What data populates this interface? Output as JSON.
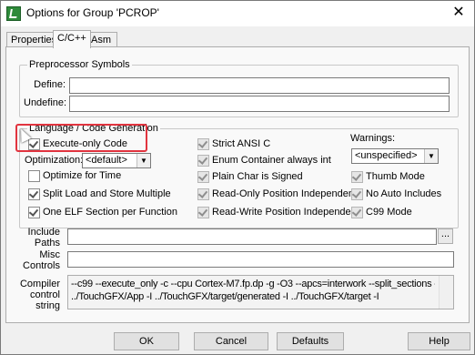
{
  "window": {
    "title": "Options for Group 'PCROP'",
    "close_glyph": "✕"
  },
  "tabs": [
    {
      "label": "Properties"
    },
    {
      "label": "C/C++"
    },
    {
      "label": "Asm"
    }
  ],
  "preprocessor": {
    "group_label": "Preprocessor Symbols",
    "define_label": "Define:",
    "define_value": "",
    "undefine_label": "Undefine:",
    "undefine_value": ""
  },
  "language": {
    "group_label": "Language / Code Generation",
    "execute_only": {
      "label": "Execute-only Code",
      "checked": true
    },
    "optimization": {
      "label": "Optimization:",
      "value": "<default>"
    },
    "col1": [
      {
        "label": "Optimize for Time",
        "checked": false
      },
      {
        "label": "Split Load and Store Multiple",
        "checked": true
      },
      {
        "label": "One ELF Section per Function",
        "checked": true
      }
    ],
    "col2": [
      {
        "label": "Strict ANSI C",
        "checked": true
      },
      {
        "label": "Enum Container always int",
        "checked": true
      },
      {
        "label": "Plain Char is Signed",
        "checked": true
      },
      {
        "label": "Read-Only Position Independent",
        "checked": true
      },
      {
        "label": "Read-Write Position Independent",
        "checked": true
      }
    ],
    "warnings": {
      "label": "Warnings:",
      "value": "<unspecified>"
    },
    "col3": [
      {
        "label": "Thumb Mode",
        "checked": true
      },
      {
        "label": "No Auto Includes",
        "checked": true
      },
      {
        "label": "C99 Mode",
        "checked": true
      }
    ]
  },
  "include_paths": {
    "label_line1": "Include",
    "label_line2": "Paths",
    "browse": "..."
  },
  "misc_controls": {
    "label_line1": "Misc",
    "label_line2": "Controls"
  },
  "compiler": {
    "label_line1": "Compiler",
    "label_line2": "control",
    "label_line3": "string",
    "line1": "--c99 --execute_only -c --cpu Cortex-M7.fp.dp -g -O3 --apcs=interwork --split_sections -I ../Core/Inc -I",
    "line2": "../TouchGFX/App -I ../TouchGFX/target/generated -I ../TouchGFX/target -I"
  },
  "buttons": {
    "ok": "OK",
    "cancel": "Cancel",
    "defaults": "Defaults",
    "help": "Help"
  },
  "colors": {
    "highlight": "#e1343f",
    "title_icon": "#2e8b3a"
  }
}
